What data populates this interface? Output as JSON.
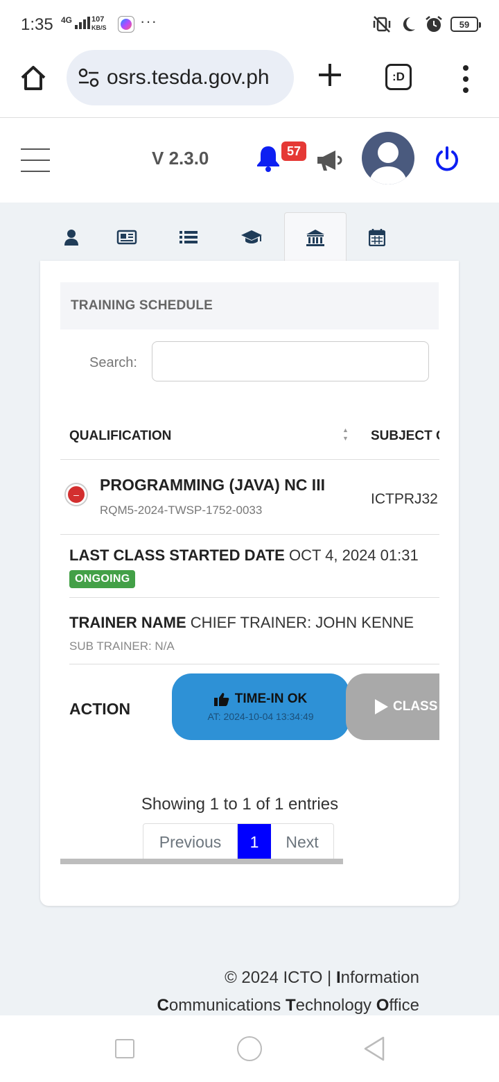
{
  "status_bar": {
    "time": "1:35",
    "network": "4G",
    "speed_value": "107",
    "speed_unit": "KB/S",
    "more": "···",
    "battery": "59"
  },
  "browser": {
    "url": "osrs.tesda.gov.ph",
    "tabs_label": ":D"
  },
  "header": {
    "version": "V 2.3.0",
    "notification_count": "57"
  },
  "tabs": [
    {
      "icon": "user-icon"
    },
    {
      "icon": "newspaper-icon"
    },
    {
      "icon": "list-icon"
    },
    {
      "icon": "graduation-cap-icon"
    },
    {
      "icon": "institution-icon",
      "active": true
    },
    {
      "icon": "calendar-icon"
    }
  ],
  "card": {
    "title": "TRAINING SCHEDULE",
    "search_label": "Search:",
    "search_value": ""
  },
  "table": {
    "columns": [
      "QUALIFICATION",
      "SUBJECT CODE"
    ],
    "row": {
      "qualification": "PROGRAMMING (JAVA) NC III",
      "code": "RQM5-2024-TWSP-1752-0033",
      "subject": "ICTPRJ32",
      "last_class_label": "LAST CLASS STARTED DATE",
      "last_class_value": "OCT 4, 2024 01:31",
      "status": "ONGOING",
      "trainer_label": "TRAINER NAME",
      "trainer_value": "CHIEF TRAINER: JOHN KENNE",
      "sub_trainer": "SUB TRAINER: N/A",
      "action_label": "ACTION",
      "timein_label": "TIME-IN OK",
      "timein_at": "AT: 2024-10-04 13:34:49",
      "class_label": "CLASS"
    }
  },
  "pagination": {
    "info": "Showing 1 to 1 of 1 entries",
    "previous": "Previous",
    "page": "1",
    "next": "Next"
  },
  "footer": {
    "prefix": "© 2024 ICTO | ",
    "i": "I",
    "w1": "nformation",
    "c": "C",
    "w2": "ommunications ",
    "t": "T",
    "w3": "echnology ",
    "o": "O",
    "w4": "ffice"
  },
  "colors": {
    "accent_blue": "#2e91d6",
    "status_green": "#43a047",
    "badge_red": "#e53935",
    "page_active": "#0000ff"
  }
}
